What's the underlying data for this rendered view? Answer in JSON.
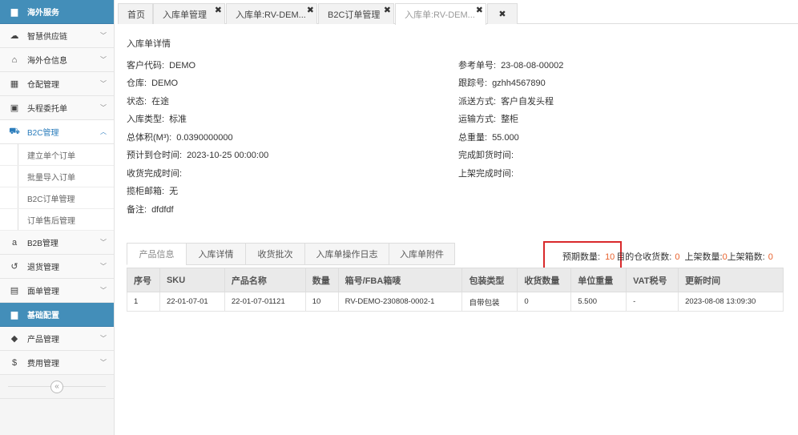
{
  "sidebar": {
    "items": [
      {
        "label": "海外服务",
        "icon": "folder-icon",
        "glyph": "▆",
        "type": "header"
      },
      {
        "label": "智慧供应链",
        "icon": "cloud-icon",
        "glyph": "☁",
        "type": "item"
      },
      {
        "label": "海外仓信息",
        "icon": "home-icon",
        "glyph": "⌂",
        "type": "item"
      },
      {
        "label": "仓配管理",
        "icon": "grid-icon",
        "glyph": "▦",
        "type": "item"
      },
      {
        "label": "头程委托单",
        "icon": "briefcase-icon",
        "glyph": "▣",
        "type": "item"
      },
      {
        "label": "B2C管理",
        "icon": "cart-icon",
        "glyph": "⛟",
        "type": "open"
      },
      {
        "label": "建立单个订单",
        "type": "sub"
      },
      {
        "label": "批量导入订单",
        "type": "sub"
      },
      {
        "label": "B2C订单管理",
        "type": "sub"
      },
      {
        "label": "订单售后管理",
        "type": "sub"
      },
      {
        "label": "B2B管理",
        "icon": "amazon-icon",
        "glyph": "a",
        "type": "item"
      },
      {
        "label": "退货管理",
        "icon": "return-icon",
        "glyph": "↺",
        "type": "item"
      },
      {
        "label": "面单管理",
        "icon": "document-icon",
        "glyph": "▤",
        "type": "item"
      },
      {
        "label": "基础配置",
        "icon": "folder-icon",
        "glyph": "▆",
        "type": "header"
      },
      {
        "label": "产品管理",
        "icon": "tag-icon",
        "glyph": "◆",
        "type": "item"
      },
      {
        "label": "费用管理",
        "icon": "dollar-icon",
        "glyph": "$",
        "type": "item"
      }
    ],
    "collapse_glyph": "«"
  },
  "tabs": [
    {
      "label": "首页",
      "close": false,
      "active": false
    },
    {
      "label": "入库单管理",
      "close": true,
      "active": false
    },
    {
      "label": "入库单:RV-DEM...",
      "close": true,
      "active": false
    },
    {
      "label": "B2C订单管理",
      "close": true,
      "active": false
    },
    {
      "label": "入库单:RV-DEM...",
      "close": true,
      "active": true
    }
  ],
  "close_glyph": "✖",
  "page_title": "入库单详情",
  "fields": {
    "left": [
      {
        "label": "客户代码:",
        "value": "DEMO"
      },
      {
        "label": "仓库:",
        "value": "DEMO"
      },
      {
        "label": "状态:",
        "value": "在途"
      },
      {
        "label": "入库类型:",
        "value": "标准"
      },
      {
        "label": "总体积(M³):",
        "value": "0.0390000000"
      },
      {
        "label": "预计到仓时间:",
        "value": "2023-10-25 00:00:00"
      },
      {
        "label": "收货完成时间:",
        "value": ""
      },
      {
        "label": "揽柜邮箱:",
        "value": "无"
      },
      {
        "label": "备注:",
        "value": "dfdfdf"
      }
    ],
    "right": [
      {
        "label": "参考单号:",
        "value": "23-08-08-00002"
      },
      {
        "label": "跟踪号:",
        "value": "gzhh4567890"
      },
      {
        "label": "派送方式:",
        "value": "客户自发头程"
      },
      {
        "label": "运输方式:",
        "value": "整柜"
      },
      {
        "label": "总重量:",
        "value": "55.000"
      },
      {
        "label": "完成卸货时间:",
        "value": ""
      },
      {
        "label": "上架完成时间:",
        "value": ""
      }
    ]
  },
  "subtabs": [
    "产品信息",
    "入库详情",
    "收货批次",
    "入库单操作日志",
    "入库单附件"
  ],
  "counts": {
    "expected_label": "预期数量:",
    "expected_value": "10",
    "received_label": "目的仓收货数:",
    "received_value": "0",
    "shelved_label": "上架数量:",
    "shelved_value": "0",
    "boxes_label": "上架箱数:",
    "boxes_value": "0"
  },
  "table": {
    "headers": [
      "序号",
      "SKU",
      "产品名称",
      "数量",
      "箱号/FBA箱唛",
      "包装类型",
      "收货数量",
      "单位重量",
      "VAT税号",
      "更新时间"
    ],
    "rows": [
      [
        "1",
        "22-01-07-01",
        "22-01-07-01121",
        "10",
        "RV-DEMO-230808-0002-1",
        "自带包装",
        "0",
        "5.500",
        "-",
        "2023-08-08 13:09:30"
      ]
    ]
  },
  "colors": {
    "accent": "#438eb9",
    "highlight_border": "#d9292b",
    "count_number": "#e8612c"
  }
}
